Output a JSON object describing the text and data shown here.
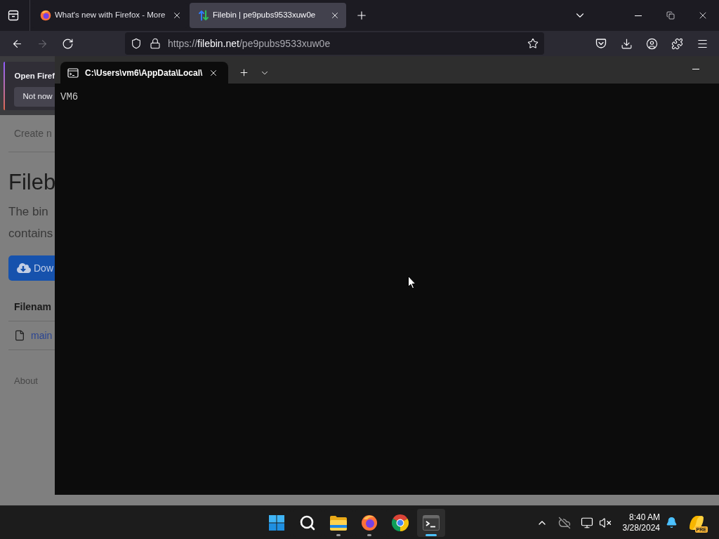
{
  "browser": {
    "tabs": [
      {
        "kind": "firefox",
        "title": "What's new with Firefox - More",
        "selected": false
      },
      {
        "kind": "filebin",
        "title": "Filebin | pe9pubs9533xuw0e",
        "selected": true
      }
    ],
    "nav": [
      {
        "kind": "back",
        "disabled": false
      },
      {
        "kind": "forward",
        "disabled": true
      },
      {
        "kind": "reload",
        "disabled": false
      }
    ],
    "url": {
      "scheme": "https://",
      "domain": "filebin.net",
      "path": "/pe9pubs9533xuw0e"
    }
  },
  "page": {
    "notification": {
      "title": "Open Firef",
      "button": "Not now"
    },
    "nav_link": "Create n",
    "heading": "Fileb",
    "description": [
      "The bin",
      "contains"
    ],
    "download_button": "Dow",
    "table": {
      "column_1": "Filenam",
      "rows": [
        {
          "name": "main"
        }
      ]
    },
    "footer_links": [
      "About"
    ]
  },
  "terminal": {
    "tabs": [
      {
        "title": "C:\\Users\\vm6\\AppData\\Local\\",
        "selected": true
      }
    ],
    "output": [
      "VM6"
    ]
  },
  "taskbar": {
    "apps": [
      {
        "kind": "start",
        "running": false,
        "selected": false
      },
      {
        "kind": "search",
        "running": false,
        "selected": false
      },
      {
        "kind": "files",
        "running": true,
        "selected": false
      },
      {
        "kind": "firefox",
        "running": true,
        "selected": false
      },
      {
        "kind": "chrome",
        "running": false,
        "selected": false
      },
      {
        "kind": "terminal",
        "running": true,
        "selected": true
      }
    ],
    "tray": {
      "volume_muted": true
    },
    "clock": {
      "time": "8:40 AM",
      "date": "3/28/2024"
    },
    "widget": {
      "badge": "PRE"
    }
  }
}
